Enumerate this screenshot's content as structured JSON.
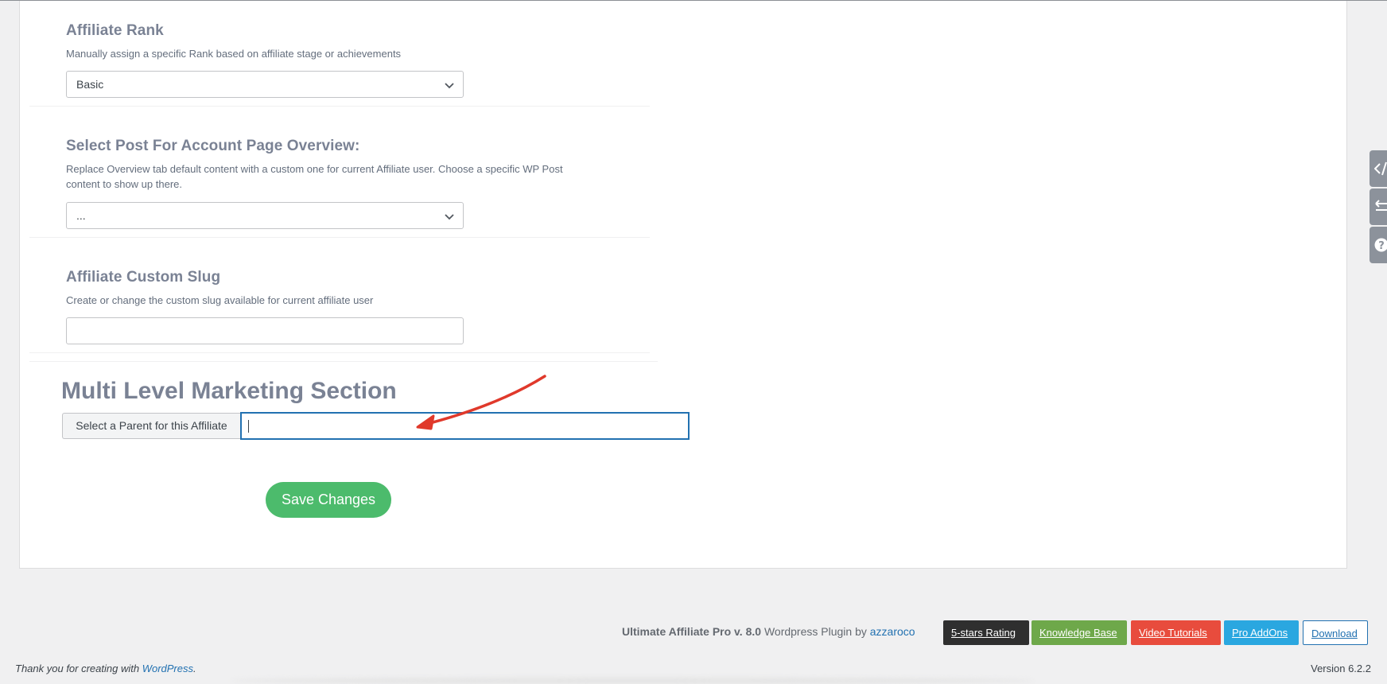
{
  "fields": {
    "rank": {
      "title": "Affiliate Rank",
      "description": "Manually assign a specific Rank based on affiliate stage or achievements",
      "selected": "Basic"
    },
    "overview_post": {
      "title": "Select Post For Account Page Overview:",
      "description_line1": "Replace Overview tab default content with a custom one for current Affiliate user. Choose a specific WP Post",
      "description_line2": "content to show up there.",
      "selected": "..."
    },
    "custom_slug": {
      "title": "Affiliate Custom Slug",
      "description": "Create or change the custom slug available for current affiliate user",
      "value": ""
    }
  },
  "mlm": {
    "title": "Multi Level Marketing Section",
    "parent_label": "Select a Parent for this Affiliate",
    "parent_value": ""
  },
  "save_label": "Save Changes",
  "side_tabs": [
    {
      "icon": "code-icon"
    },
    {
      "icon": "arrows-icon"
    },
    {
      "icon": "help-icon"
    }
  ],
  "footer": {
    "plugin_name": "Ultimate Affiliate Pro v. 8.0",
    "plugin_text": " Wordpress Plugin by ",
    "author": "azzaroco",
    "badges": [
      "5-stars Rating",
      "Knowledge Base",
      "Video Tutorials",
      "Pro AddOns",
      "Download"
    ],
    "thanks_prefix": "Thank you for creating with ",
    "thanks_link": "WordPress",
    "thanks_suffix": ".",
    "version": "Version 6.2.2"
  },
  "colors": {
    "save": "#4cbb6c",
    "focus": "#2271b1",
    "arrow": "#e0392b"
  }
}
